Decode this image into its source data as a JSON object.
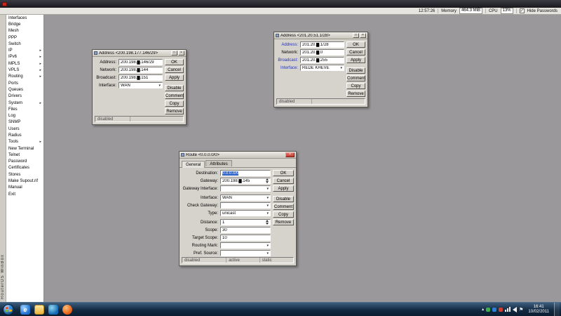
{
  "colors": {
    "workspace": "#9a989a",
    "dialog_bg": "#d6d3cc",
    "selection_blue": "#2e62c9",
    "close_button_red": "#c03a30",
    "titlebar_dark": "#2b2b31",
    "sidebar_bg": "#ffffff",
    "redaction_black": "#000000",
    "taskbar_blue": "#122a42"
  },
  "icons": {
    "maximize": "□",
    "close": "×",
    "caret": "▾",
    "check": "✓",
    "ie_glyph": "e",
    "tray_expand": "▴",
    "flag": "⚑"
  },
  "toolbar": {
    "time": "12:57:26",
    "memory_label": "Memory",
    "memory_value": "464.3 MiB",
    "cpu_label": "CPU",
    "cpu_value": "13%",
    "hide_passwords": "Hide Passwords"
  },
  "brand": {
    "vertical_text": "RouterOS WinBox"
  },
  "sidebar": {
    "items": [
      {
        "label": "Interfaces",
        "arrow": ""
      },
      {
        "label": "Bridge",
        "arrow": ""
      },
      {
        "label": "Mesh",
        "arrow": ""
      },
      {
        "label": "PPP",
        "arrow": ""
      },
      {
        "label": "Switch",
        "arrow": ""
      },
      {
        "label": "IP",
        "arrow": "▸"
      },
      {
        "label": "IPv6",
        "arrow": "▸"
      },
      {
        "label": "MPLS",
        "arrow": "▸"
      },
      {
        "label": "VPLS",
        "arrow": "▸"
      },
      {
        "label": "Routing",
        "arrow": "▸"
      },
      {
        "label": "Ports",
        "arrow": ""
      },
      {
        "label": "Queues",
        "arrow": ""
      },
      {
        "label": "Drivers",
        "arrow": ""
      },
      {
        "label": "System",
        "arrow": "▸"
      },
      {
        "label": "Files",
        "arrow": ""
      },
      {
        "label": "Log",
        "arrow": ""
      },
      {
        "label": "SNMP",
        "arrow": ""
      },
      {
        "label": "Users",
        "arrow": ""
      },
      {
        "label": "Radius",
        "arrow": ""
      },
      {
        "label": "Tools",
        "arrow": "▸"
      },
      {
        "label": "New Terminal",
        "arrow": ""
      },
      {
        "label": "Telnet",
        "arrow": ""
      },
      {
        "label": "Password",
        "arrow": ""
      },
      {
        "label": "Certificates",
        "arrow": ""
      },
      {
        "label": "Stores",
        "arrow": ""
      },
      {
        "label": "Make Supout.rif",
        "arrow": ""
      },
      {
        "label": "Manual",
        "arrow": ""
      },
      {
        "label": "Exit",
        "arrow": ""
      }
    ]
  },
  "dialogs": {
    "address1": {
      "title": "Address <200.198.177.146/29>",
      "address_label": "Address:",
      "address_value": "200.198.█.146/29",
      "network_label": "Network:",
      "network_value": "200.198.█.144",
      "broadcast_label": "Broadcast:",
      "broadcast_value": "200.198.█.151",
      "interface_label": "Interface:",
      "interface_value": "WAN",
      "buttons": {
        "ok": "OK",
        "cancel": "Cancel",
        "apply": "Apply",
        "disable": "Disable",
        "comment": "Comment",
        "copy": "Copy",
        "remove": "Remove"
      },
      "status": "disabled"
    },
    "address2": {
      "title": "Address <201.20.51.1/28>",
      "address_label": "Address:",
      "address_value": "201.20.█.1/28",
      "network_label": "Network:",
      "network_value": "201.20.█.0",
      "broadcast_label": "Broadcast:",
      "broadcast_value": "201.20.█.255",
      "interface_label": "Interface:",
      "interface_value": "REDE KHEVE",
      "buttons": {
        "ok": "OK",
        "cancel": "Cancel",
        "apply": "Apply",
        "disable": "Disable",
        "comment": "Comment",
        "copy": "Copy",
        "remove": "Remove"
      },
      "status": "disabled"
    },
    "route": {
      "title": "Route <0.0.0.0/0>",
      "tabs": {
        "general": "General",
        "attributes": "Attributes"
      },
      "destination_label": "Destination:",
      "destination_value": "0.0.0.0/0",
      "gateway_label": "Gateway:",
      "gateway_value": "200.198.█.145",
      "gateway_interface_label": "Gateway Interface:",
      "gateway_interface_value": "",
      "interface_label": "Interface:",
      "interface_value": "WAN",
      "check_gateway_label": "Check Gateway:",
      "check_gateway_value": "",
      "type_label": "Type:",
      "type_value": "unicast",
      "distance_label": "Distance:",
      "distance_value": "1",
      "scope_label": "Scope:",
      "scope_value": "30",
      "target_scope_label": "Target Scope:",
      "target_scope_value": "10",
      "routing_mark_label": "Routing Mark:",
      "routing_mark_value": "",
      "pref_source_label": "Pref. Source:",
      "pref_source_value": "",
      "buttons": {
        "ok": "OK",
        "cancel": "Cancel",
        "apply": "Apply",
        "disable": "Disable",
        "comment": "Comment",
        "copy": "Copy",
        "remove": "Remove"
      },
      "status_left": "disabled",
      "status_mid": "active",
      "status_right": "static"
    }
  },
  "taskbar": {
    "clock_time": "16:41",
    "clock_date": "10/02/2011"
  }
}
